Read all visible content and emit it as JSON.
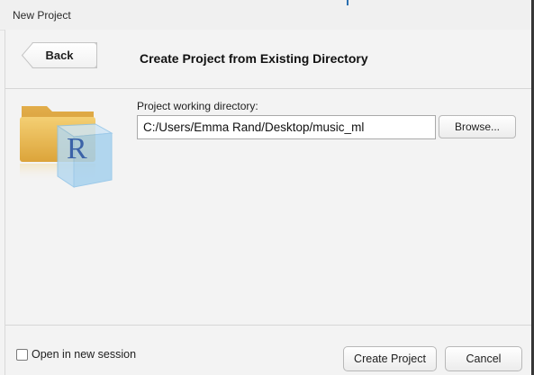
{
  "window": {
    "title": "New Project"
  },
  "header": {
    "back_label": "Back",
    "page_title": "Create Project from Existing Directory"
  },
  "form": {
    "directory_label": "Project working directory:",
    "directory_value": "C:/Users/Emma Rand/Desktop/music_ml",
    "browse_label": "Browse...",
    "folder_icon_name": "folder-r-icon",
    "folder_icon_letter": "R"
  },
  "footer": {
    "open_new_session_label": "Open in new session",
    "open_new_session_checked": false,
    "create_label": "Create Project",
    "cancel_label": "Cancel"
  },
  "colors": {
    "folder": "#e8b54a",
    "r_cube": "#8fc3e8",
    "r_letter": "#3b63a8"
  }
}
